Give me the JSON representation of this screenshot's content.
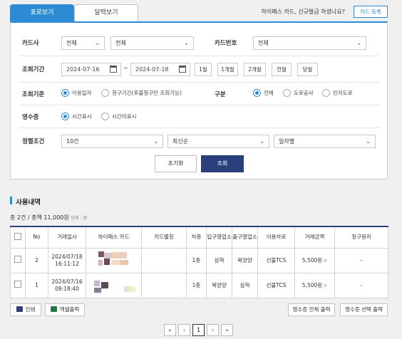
{
  "tabs": [
    {
      "label": "표로보기",
      "active": true
    },
    {
      "label": "달력보기",
      "active": false
    }
  ],
  "promo_text": "하이패스 카드, 신규발급 하셨나요?",
  "card_register_label": "카드 등록",
  "filters": {
    "card_company": {
      "label": "카드사",
      "value1": "전체",
      "value2": "전체"
    },
    "card_number": {
      "label": "카드번호",
      "value": "전체"
    },
    "period": {
      "label": "조회기간",
      "start": "2024-07-16",
      "tilde": "~",
      "end": "2024-07-18",
      "presets": [
        "1월",
        "1개월",
        "2개월",
        "전월",
        "당월"
      ]
    },
    "criteria": {
      "label": "조회기준",
      "options": [
        {
          "label": "이용일자",
          "checked": true
        },
        {
          "label": "청구기간(후불청구만 조회가능)",
          "checked": false
        }
      ]
    },
    "division": {
      "label": "구분",
      "options": [
        {
          "label": "전체",
          "checked": true
        },
        {
          "label": "도로공사",
          "checked": false
        },
        {
          "label": "민자도로",
          "checked": false
        }
      ]
    },
    "receipt": {
      "label": "영수증",
      "options": [
        {
          "label": "시간표시",
          "checked": true
        },
        {
          "label": "시간미표시",
          "checked": false
        }
      ]
    },
    "sort": {
      "label": "정렬조건",
      "count": "10건",
      "order": "최신순",
      "basis": "일자별"
    },
    "reset_label": "초기화",
    "search_label": "조회"
  },
  "results": {
    "title": "사용내역",
    "summary": "총 2건 / 총액 11,000원",
    "unit": "단위 : 원",
    "columns": [
      "No",
      "거래일시",
      "하이패스 카드",
      "카드별칭",
      "차종",
      "입구영업소",
      "출구영업소",
      "이용차로",
      "거래금액",
      "청구원자"
    ],
    "rows": [
      {
        "no": "2",
        "date": "2024/07/18",
        "time": "16:11:12",
        "alias": "",
        "vehicle": "1종",
        "entry": "삼척",
        "exit": "묵양양",
        "lane": "선불TCS",
        "amount": "5,500원",
        "claim": "-"
      },
      {
        "no": "1",
        "date": "2024/07/16",
        "time": "09:18:40",
        "alias": "",
        "vehicle": "1종",
        "entry": "묵양양",
        "exit": "삼척",
        "lane": "선불TCS",
        "amount": "5,500원",
        "claim": "-"
      }
    ]
  },
  "footer": {
    "print_label": "인쇄",
    "excel_label": "엑셀출력",
    "receipt_all_label": "영수증 전체 출력",
    "receipt_sel_label": "영수증 선택 출력"
  },
  "pagination": {
    "first": "«",
    "prev": "‹",
    "current": "1",
    "next": "›",
    "last": "»"
  },
  "colors": {
    "accent": "#2d8bd4",
    "navy": "#2a3f7b"
  }
}
